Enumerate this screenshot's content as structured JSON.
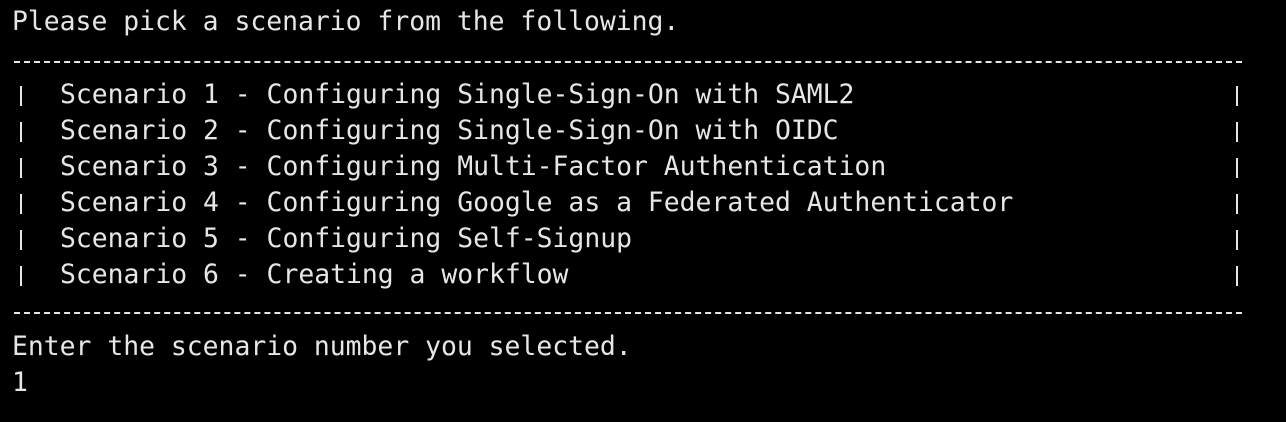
{
  "terminal": {
    "background": "#000000",
    "foreground": "#e6e6e6",
    "prompt": "Please pick a scenario from the following.",
    "scenarios": [
      {
        "label": "Scenario 1 - Configuring Single-Sign-On with SAML2"
      },
      {
        "label": "Scenario 2 - Configuring Single-Sign-On with OIDC"
      },
      {
        "label": "Scenario 3 - Configuring Multi-Factor Authentication"
      },
      {
        "label": "Scenario 4 - Configuring Google as a Federated Authenticator"
      },
      {
        "label": "Scenario 5 - Configuring Self-Signup"
      },
      {
        "label": "Scenario 6 - Creating a workflow"
      }
    ],
    "input_prompt": "Enter the scenario number you selected.",
    "input_value": "1"
  }
}
